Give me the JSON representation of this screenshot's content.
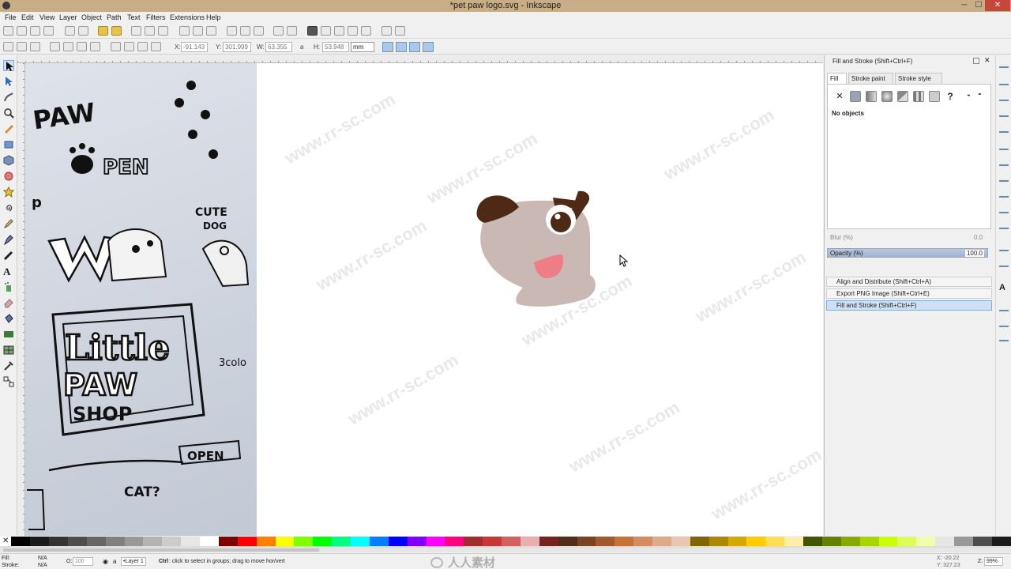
{
  "window": {
    "title": "*pet paw logo.svg - Inkscape",
    "min": "─",
    "max": "☐",
    "close": "✕"
  },
  "menu": [
    "File",
    "Edit",
    "View",
    "Layer",
    "Object",
    "Path",
    "Text",
    "Filters",
    "Extensions",
    "Help"
  ],
  "controls": {
    "x_label": "X:",
    "x_value": "-91.143",
    "y_label": "Y:",
    "y_value": "301.999",
    "w_label": "W:",
    "w_value": "63.355",
    "h_label": "H:",
    "h_value": "53.948",
    "unit": "mm"
  },
  "panel": {
    "title": "Fill and Stroke (Shift+Ctrl+F)",
    "tabs": [
      "Fill",
      "Stroke paint",
      "Stroke style"
    ],
    "no_objects": "No objects",
    "blur_label": "Blur (%)",
    "blur_value": "0.0",
    "opacity_label": "Opacity (%)",
    "opacity_value": "100.0",
    "docked": [
      "Align and Distribute (Shift+Ctrl+A)",
      "Export PNG Image (Shift+Ctrl+E)",
      "Fill and Stroke (Shift+Ctrl+F)"
    ]
  },
  "status": {
    "fill_label": "Fill:",
    "fill_value": "N/A",
    "stroke_label": "Stroke:",
    "stroke_value": "N/A",
    "o_label": "O:",
    "o_value": "100",
    "layer": "•Layer 1",
    "message_key": "Ctrl",
    "message": ": click to select in groups; drag to move hor/vert",
    "coord_x": "X: -20.22",
    "coord_y": "Y: 327.23",
    "z_label": "Z:",
    "zoom": "99%"
  },
  "watermark": "www.rr-sc.com",
  "bottom_logo": "人人素材",
  "sketch_words": [
    "PAW",
    "PEN",
    "CUTE",
    "DOG",
    "Little",
    "PAW",
    "SHOP",
    "OPEN",
    "CAT?",
    "3colo"
  ],
  "colors": {
    "dog_body": "#c9b8b3",
    "dog_ear": "#4e2a16",
    "dog_eye": "#ffffff",
    "dog_pupil": "#4e2a16",
    "dog_tongue": "#ee7d85",
    "titlebar": "#c8ad86",
    "selected_blue": "#cde0f6"
  }
}
